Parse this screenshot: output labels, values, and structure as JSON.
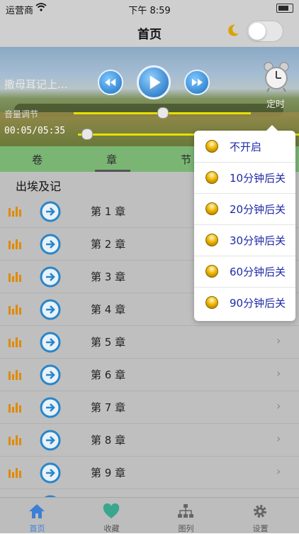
{
  "status_bar": {
    "carrier": "运营商",
    "time": "下午 8:59"
  },
  "nav": {
    "title": "首页",
    "night_mode_on": false
  },
  "player": {
    "track_title": "撒母耳记上...",
    "volume_label": "音量调节",
    "volume_level": 0.5,
    "time_readout": "00:05/05:35",
    "progress": 0.015,
    "timer_label": "定时"
  },
  "seg_tabs": [
    "卷",
    "章",
    "节"
  ],
  "active_seg_tab": "章",
  "book_title": "出埃及记",
  "chapters": [
    "第 1 章",
    "第 2 章",
    "第 3 章",
    "第 4 章",
    "第 5 章",
    "第 6 章",
    "第 7 章",
    "第 8 章",
    "第 9 章"
  ],
  "timer_menu": [
    "不开启",
    "10分钟后关",
    "20分钟后关",
    "30分钟后关",
    "60分钟后关",
    "90分钟后关"
  ],
  "tab_bar": [
    {
      "label": "首页",
      "icon": "home-icon"
    },
    {
      "label": "收藏",
      "icon": "heart-icon"
    },
    {
      "label": "图列",
      "icon": "hierarchy-icon"
    },
    {
      "label": "设置",
      "icon": "gear-icon"
    }
  ],
  "colors": {
    "accent": "#3c7fd6",
    "seg_tab_bg": "#7ab574",
    "slider": "#e6e000",
    "menu_text": "#1e2aa8"
  }
}
